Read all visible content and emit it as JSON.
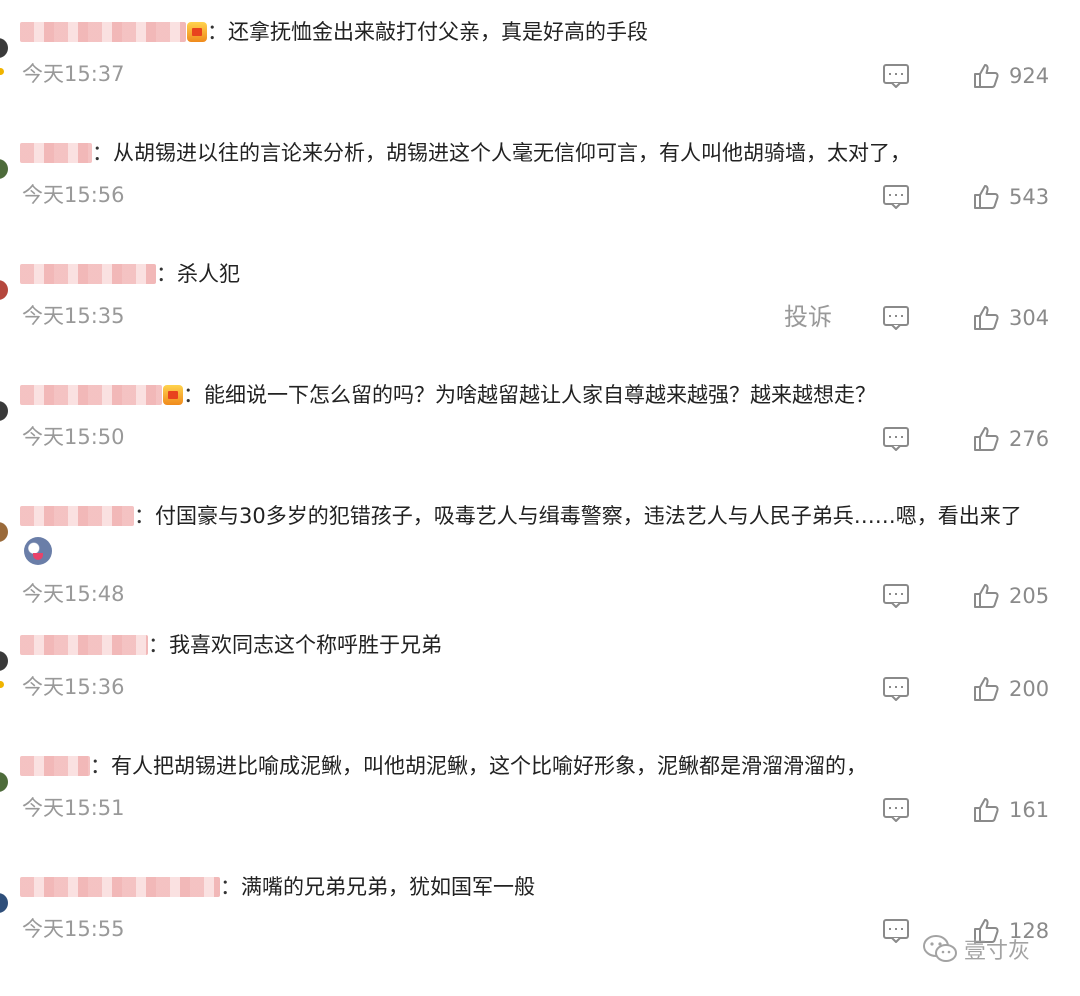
{
  "comments": [
    {
      "user_width": 166,
      "vip": true,
      "text": "还拿抚恤金出来敲打付父亲，真是好高的手段",
      "time": "今天15:37",
      "likes": "924",
      "report": ""
    },
    {
      "user_width": 72,
      "vip": false,
      "text": "从胡锡进以往的言论来分析，胡锡进这个人毫无信仰可言，有人叫他胡骑墙，太对了，",
      "time": "今天15:56",
      "likes": "543",
      "report": ""
    },
    {
      "user_width": 136,
      "vip": false,
      "text": "杀人犯",
      "time": "今天15:35",
      "likes": "304",
      "report": "投诉"
    },
    {
      "user_width": 142,
      "vip": true,
      "text": "能细说一下怎么留的吗？为啥越留越让人家自尊越来越强？越来越想走？",
      "time": "今天15:50",
      "likes": "276",
      "report": ""
    },
    {
      "user_width": 114,
      "vip": false,
      "text": "付国豪与30多岁的犯错孩子，吸毒艺人与缉毒警察，违法艺人与人民子弟兵……嗯，看出来了",
      "time": "今天15:48",
      "likes": "205",
      "report": ""
    },
    {
      "user_width": 128,
      "vip": false,
      "text": "我喜欢同志这个称呼胜于兄弟",
      "time": "今天15:36",
      "likes": "200",
      "report": ""
    },
    {
      "user_width": 70,
      "vip": false,
      "text": "有人把胡锡进比喻成泥鳅，叫他胡泥鳅，这个比喻好形象，泥鳅都是滑溜滑溜的，",
      "time": "今天15:51",
      "likes": "161",
      "report": ""
    },
    {
      "user_width": 200,
      "vip": false,
      "text": "满嘴的兄弟兄弟，犹如国军一般",
      "time": "今天15:55",
      "likes": "128",
      "report": ""
    }
  ],
  "colon": "：",
  "watermark": "壹寸灰"
}
